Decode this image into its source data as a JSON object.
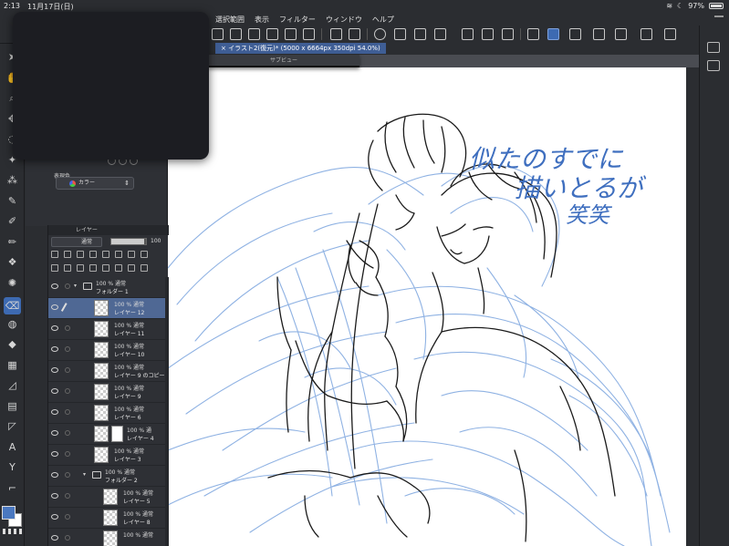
{
  "status": {
    "time": "2:13",
    "date": "11月17日(日)",
    "battery": "97%"
  },
  "menu": [
    "選択範囲",
    "表示",
    "フィルター",
    "ウィンドウ",
    "ヘルプ"
  ],
  "document": {
    "tab_label": "× イラスト2(復元)* (5000 x 6664px 350dpi 54.0%)",
    "subview_label": "サブビュー"
  },
  "properties": {
    "expression_label": "表現色",
    "expression_value": "カラー"
  },
  "layer_panel": {
    "title": "レイヤー",
    "blend_mode": "通常",
    "opacity": "100",
    "layers": [
      {
        "kind": "folder",
        "indent": 0,
        "mode": "100 % 通常",
        "name": "フォルダー 1",
        "selected": false
      },
      {
        "kind": "layer",
        "indent": 1,
        "mode": "100 % 通常",
        "name": "レイヤー 12",
        "selected": true
      },
      {
        "kind": "layer",
        "indent": 1,
        "mode": "100 % 通常",
        "name": "レイヤー 11",
        "selected": false
      },
      {
        "kind": "layer",
        "indent": 1,
        "mode": "100 % 通常",
        "name": "レイヤー 10",
        "selected": false
      },
      {
        "kind": "layer",
        "indent": 1,
        "mode": "100 % 通常",
        "name": "レイヤー 9 のコピー",
        "selected": false
      },
      {
        "kind": "layer",
        "indent": 1,
        "mode": "100 % 通常",
        "name": "レイヤー 9",
        "selected": false
      },
      {
        "kind": "layer",
        "indent": 1,
        "mode": "100 % 通常",
        "name": "レイヤー 6",
        "selected": false
      },
      {
        "kind": "masked",
        "indent": 1,
        "mode": "100 % 通",
        "name": "レイヤー 4",
        "selected": false
      },
      {
        "kind": "layer",
        "indent": 1,
        "mode": "100 % 通常",
        "name": "レイヤー 3",
        "selected": false
      },
      {
        "kind": "folder",
        "indent": 1,
        "mode": "100 % 通常",
        "name": "フォルダー 2",
        "selected": false
      },
      {
        "kind": "layer",
        "indent": 2,
        "mode": "100 % 通常",
        "name": "レイヤー 5",
        "selected": false
      },
      {
        "kind": "layer",
        "indent": 2,
        "mode": "100 % 通常",
        "name": "レイヤー 8",
        "selected": false
      },
      {
        "kind": "layer",
        "indent": 2,
        "mode": "100 % 通常",
        "name": "",
        "selected": false
      }
    ]
  },
  "canvas": {
    "handwriting_line1": "似たのすでに",
    "handwriting_line2": "描いとるが",
    "handwriting_line3": "笑笑"
  },
  "colors": {
    "main_color": "#4a78c0",
    "sub_color": "#ffffff",
    "accent": "#3d6ab2",
    "selected_layer": "#4f6894"
  },
  "tools": [
    "cursor-icon",
    "hand-icon",
    "zoom-icon",
    "move-icon",
    "lasso-icon",
    "magic-wand-icon",
    "eyedropper-icon",
    "pen-icon",
    "brush-icon",
    "pencil-icon",
    "airbrush-icon",
    "decoration-icon",
    "eraser-icon",
    "blend-icon",
    "fill-icon",
    "gradient-icon",
    "figure-icon",
    "frame-icon",
    "ruler-icon",
    "text-icon",
    "balloon-icon",
    "correct-line-icon"
  ]
}
